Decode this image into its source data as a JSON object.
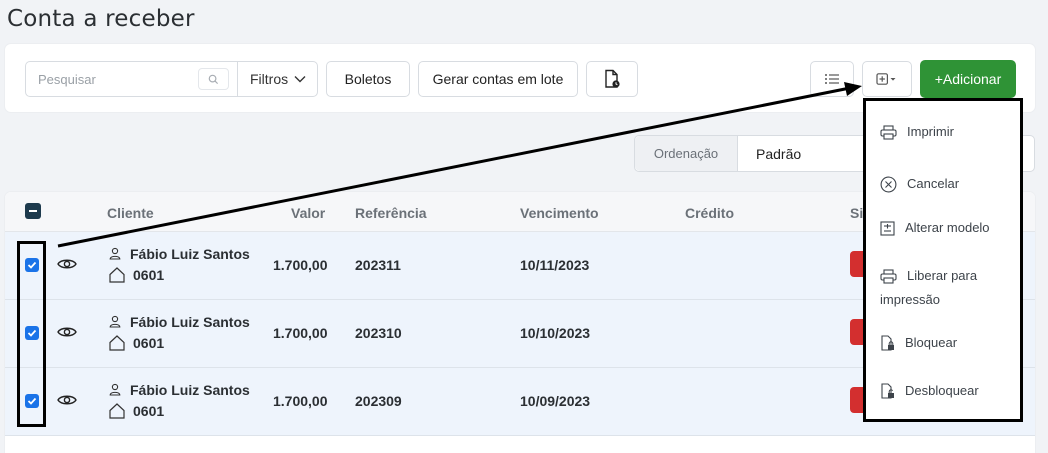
{
  "page": {
    "title": "Conta a receber"
  },
  "toolbar": {
    "search_placeholder": "Pesquisar",
    "filters_label": "Filtros",
    "boletos_label": "Boletos",
    "batch_label": "Gerar contas em lote",
    "add_label": "+Adicionar"
  },
  "sort": {
    "label": "Ordenação",
    "value": "Padrão"
  },
  "table": {
    "columns": [
      "Cliente",
      "Valor",
      "Referência",
      "Vencimento",
      "Crédito",
      "Si"
    ],
    "rows": [
      {
        "client": "Fábio Luiz Santos",
        "unit": "0601",
        "valor": "1.700,00",
        "referencia": "202311",
        "vencimento": "10/11/2023",
        "checked": true
      },
      {
        "client": "Fábio Luiz Santos",
        "unit": "0601",
        "valor": "1.700,00",
        "referencia": "202310",
        "vencimento": "10/10/2023",
        "checked": true
      },
      {
        "client": "Fábio Luiz Santos",
        "unit": "0601",
        "valor": "1.700,00",
        "referencia": "202309",
        "vencimento": "10/09/2023",
        "checked": true
      }
    ]
  },
  "menu": {
    "items": [
      {
        "label": "Imprimir",
        "icon": "printer-icon"
      },
      {
        "label": "Cancelar",
        "icon": "cancel-circle-icon"
      },
      {
        "label": "Alterar modelo",
        "icon": "edit-model-icon"
      },
      {
        "label_line1": "Liberar para",
        "label_line2": "impressão",
        "icon": "printer-release-icon"
      },
      {
        "label": "Bloquear",
        "icon": "file-lock-icon"
      },
      {
        "label": "Desbloquear",
        "icon": "file-unlock-icon"
      }
    ]
  },
  "colors": {
    "primary_green": "#2f9336",
    "check_blue": "#1a73e8",
    "status_red": "#d32f2f",
    "row_selected": "#eef4fc"
  }
}
